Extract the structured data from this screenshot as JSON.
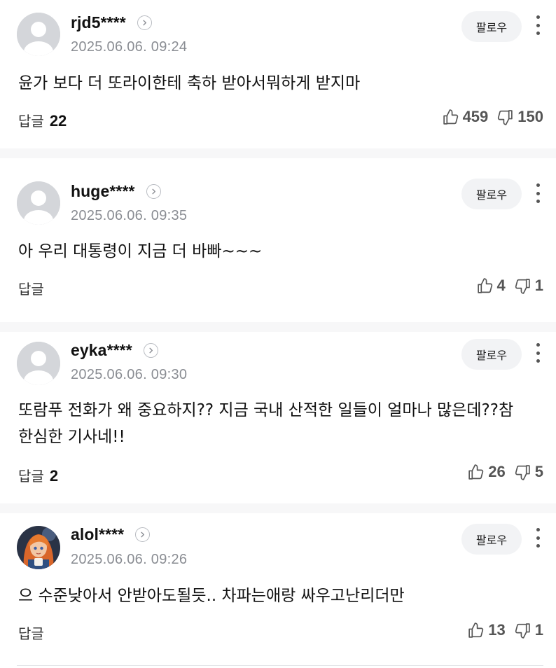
{
  "follow_label": "팔로우",
  "reply_label": "답글",
  "icons": {
    "avatar_default": "default-avatar-icon",
    "chevron": "chevron-right-icon",
    "more": "more-vertical-icon",
    "like": "thumbs-up-icon",
    "dislike": "thumbs-down-icon"
  },
  "comments": [
    {
      "nickname": "rjd5****",
      "date": "2025.06.06. 09:24",
      "text": "윤가 보다 더 또라이한테 축하 받아서뭐하게 받지마",
      "reply_count": "22",
      "likes": "459",
      "dislikes": "150",
      "avatar": "default"
    },
    {
      "nickname": "huge****",
      "date": "2025.06.06. 09:35",
      "text": "아 우리 대통령이 지금 더 바빠~~~",
      "reply_count": "",
      "likes": "4",
      "dislikes": "1",
      "avatar": "default"
    },
    {
      "nickname": "eyka****",
      "date": "2025.06.06. 09:30",
      "text": "또람푸 전화가 왜 중요하지?? 지금 국내 산적한 일들이 얼마나 많은데??참 한심한 기사네!!",
      "reply_count": "2",
      "likes": "26",
      "dislikes": "5",
      "avatar": "default"
    },
    {
      "nickname": "alol****",
      "date": "2025.06.06. 09:26",
      "text": "으 수준낮아서 안받아도될듯.. 차파는애랑 싸우고난리더만",
      "reply_count": "",
      "likes": "13",
      "dislikes": "1",
      "avatar": "illustrated"
    }
  ]
}
